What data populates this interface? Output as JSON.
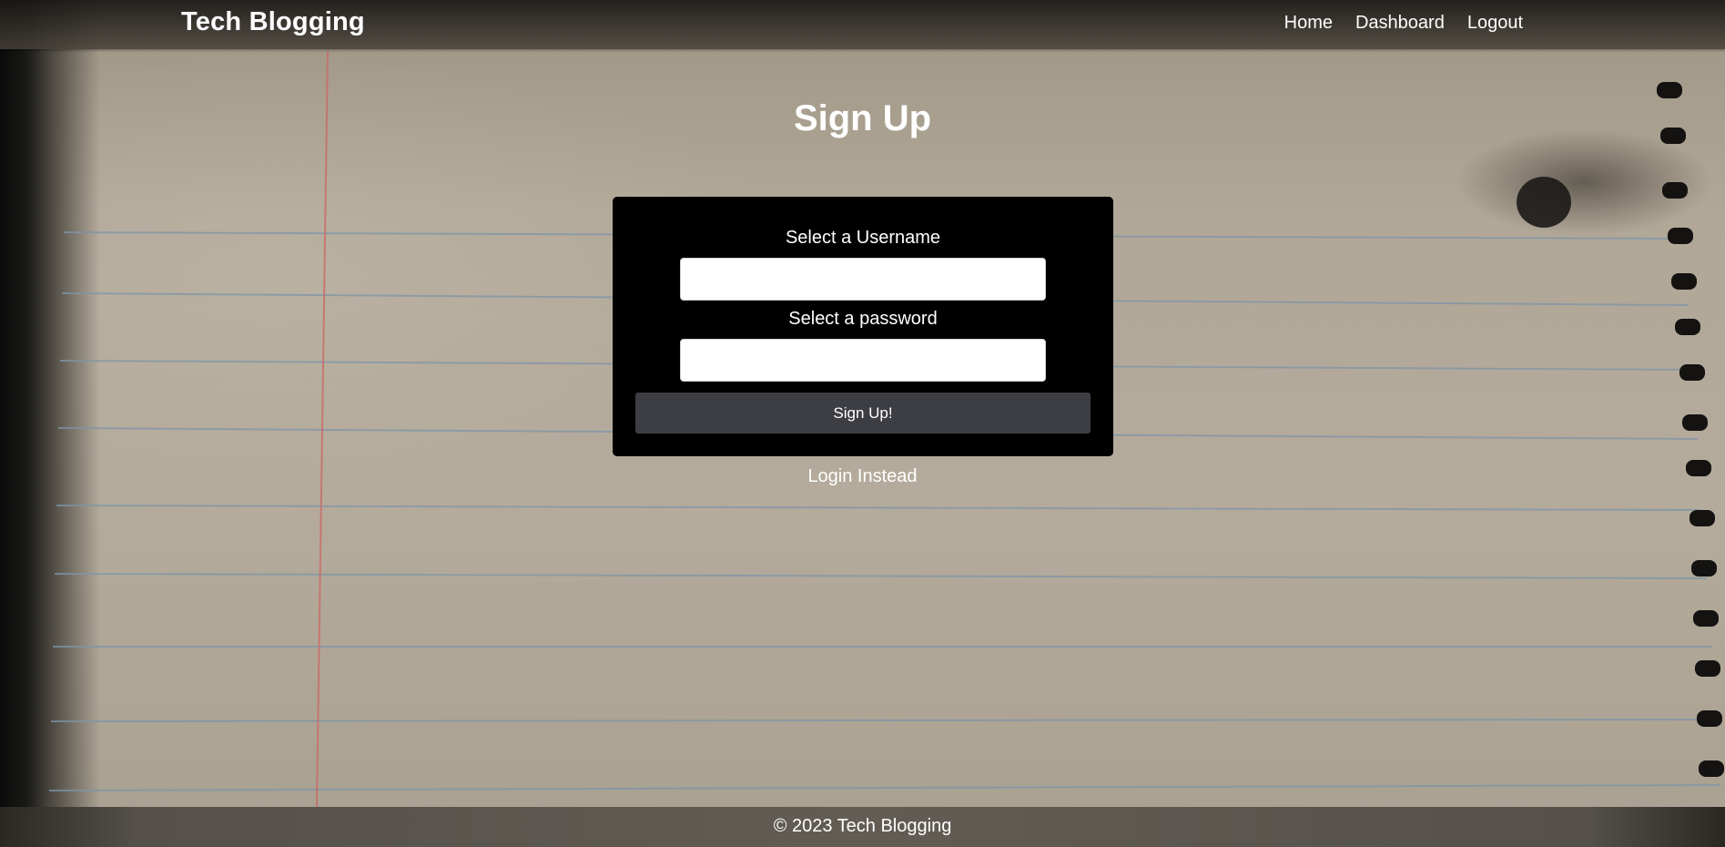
{
  "header": {
    "brand": "Tech Blogging",
    "nav": [
      {
        "label": "Home"
      },
      {
        "label": "Dashboard"
      },
      {
        "label": "Logout"
      }
    ]
  },
  "main": {
    "title": "Sign Up",
    "form": {
      "username_label": "Select a Username",
      "username_value": "",
      "password_label": "Select a password",
      "password_value": "",
      "submit_label": "Sign Up!"
    },
    "alt_link": "Login Instead"
  },
  "footer": {
    "text": "© 2023 Tech Blogging"
  },
  "colors": {
    "card_background": "#000000",
    "button_background": "#3d3e44",
    "text": "#ffffff",
    "paper": "#b1a797",
    "margin_line": "#c96a66",
    "rule_line": "#7f95a8"
  }
}
